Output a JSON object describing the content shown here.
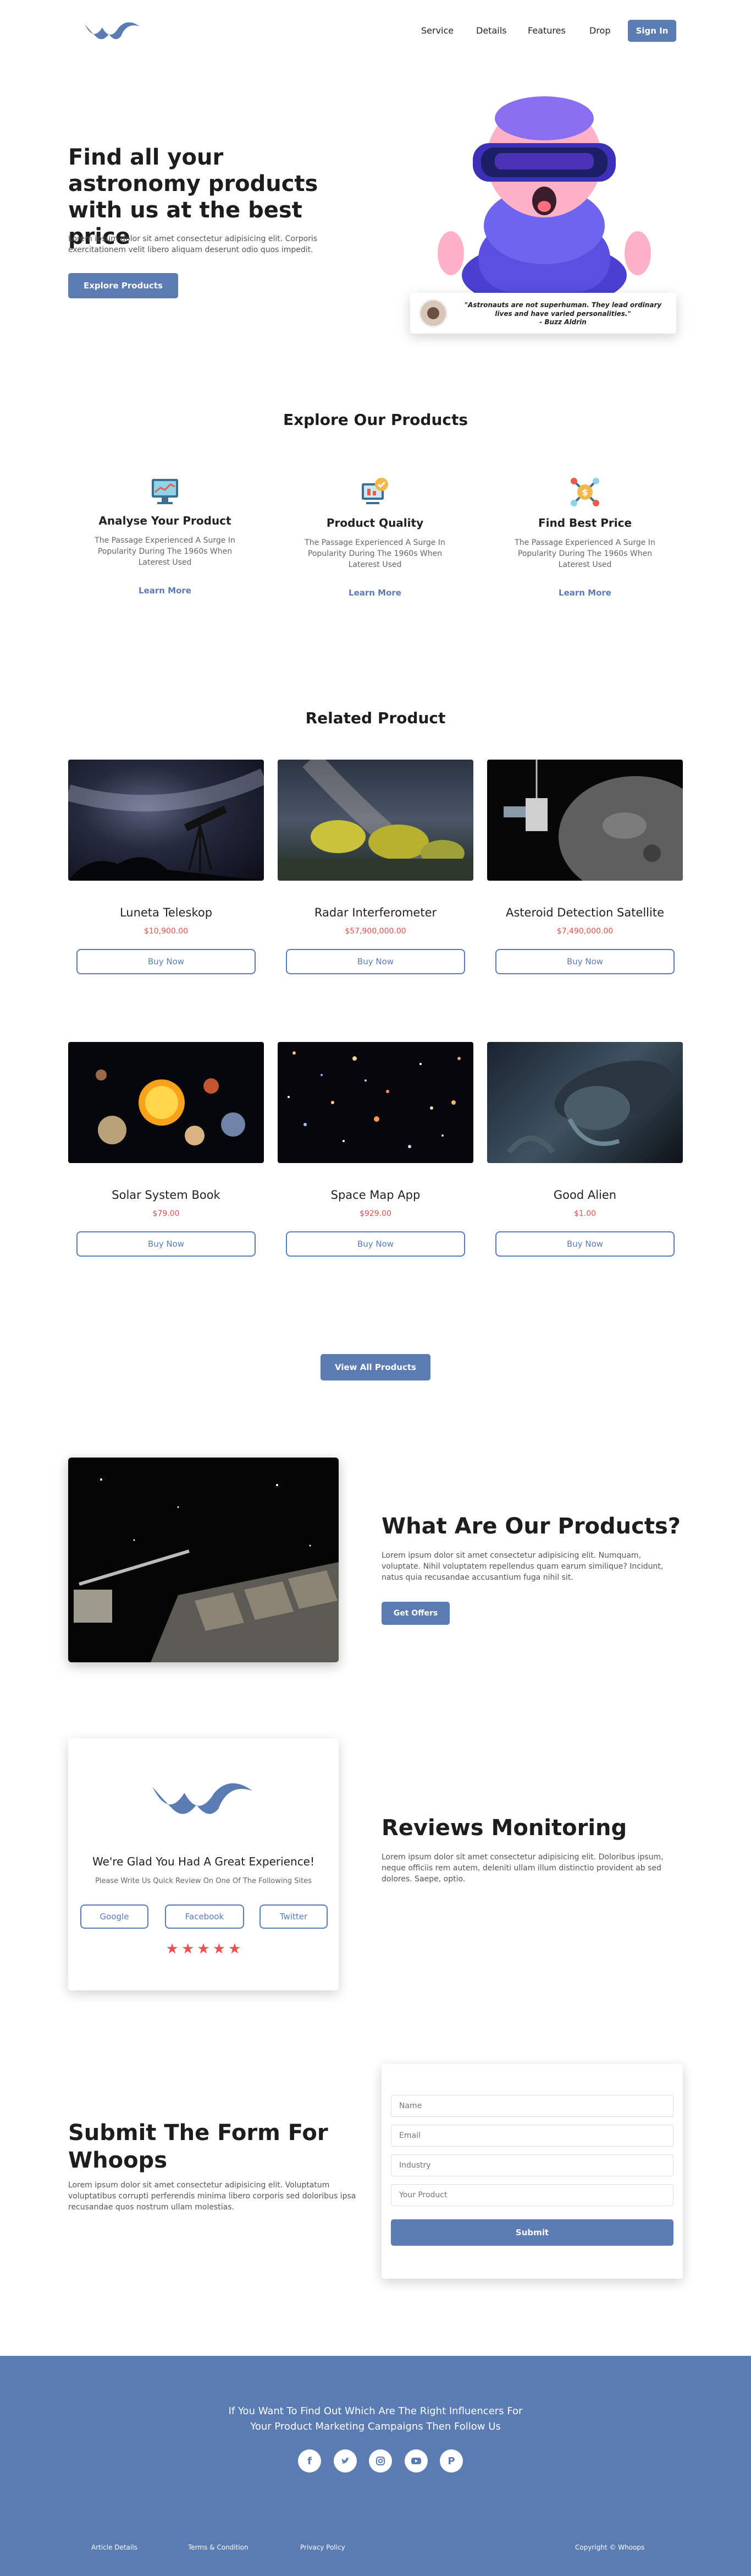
{
  "nav": {
    "items": [
      "Service",
      "Details",
      "Features",
      "Drop"
    ],
    "signin": "Sign In"
  },
  "hero": {
    "title": "Find all your astronomy products with us at the best price",
    "text": "Lorem ipsum dolor sit amet consectetur adipisicing elit. Corporis exercitationem velit libero aliquam deserunt odio quos impedit.",
    "cta": "Explore Products",
    "quote": "\"Astronauts are not superhuman. They lead ordinary lives and have varied personalities.\"",
    "quote_author": "- Buzz Aldrin"
  },
  "explore": {
    "title": "Explore Our Products",
    "features": [
      {
        "icon": "analytics-icon",
        "title": "Analyse Your Product",
        "desc": "The Passage Experienced A Surge In Popularity During The 1960s When Laterest Used",
        "link": "Learn More"
      },
      {
        "icon": "quality-icon",
        "title": "Product Quality",
        "desc": "The Passage Experienced A Surge In Popularity During The 1960s When Laterest Used",
        "link": "Learn More"
      },
      {
        "icon": "price-icon",
        "title": "Find Best Price",
        "desc": "The Passage Experienced A Surge In Popularity During The 1960s When Laterest Used",
        "link": "Learn More"
      }
    ]
  },
  "related": {
    "title": "Related Product",
    "buy_label": "Buy Now",
    "products": [
      {
        "name": "Luneta Teleskop",
        "price": "$10,900.00"
      },
      {
        "name": "Radar Interferometer",
        "price": "$57,900,000.00"
      },
      {
        "name": "Asteroid Detection Satellite",
        "price": "$7,490,000.00"
      },
      {
        "name": "Solar System Book",
        "price": "$79.00"
      },
      {
        "name": "Space Map App",
        "price": "$929.00"
      },
      {
        "name": "Good Alien",
        "price": "$1.00"
      }
    ],
    "view_all": "View All Products"
  },
  "what": {
    "title": "What Are Our Products?",
    "text": "Lorem ipsum dolor sit amet consectetur adipisicing elit. Numquam, voluptate. Nihil voluptatem repellendus quam earum similique? Incidunt, natus quia recusandae accusantium fuga nihil sit.",
    "cta": "Get Offers"
  },
  "reviews": {
    "card_title": "We're Glad You Had A Great Experience!",
    "card_sub": "Please Write Us Quick Review On One Of The Following Sites",
    "sites": [
      "Google",
      "Facebook",
      "Twitter"
    ],
    "rating": 5,
    "title": "Reviews Monitoring",
    "text": "Lorem ipsum dolor sit amet consectetur adipisicing elit. Doloribus ipsum, neque officiis rem autem, deleniti ullam illum distinctio provident ab sed dolores. Saepe, optio."
  },
  "form": {
    "title": "Submit The Form For Whoops",
    "text": "Lorem ipsum dolor sit amet consectetur adipisicing elit. Voluptatum voluptatibus corrupti perferendis minima libero corporis sed doloribus ipsa recusandae quos nostrum ullam molestias.",
    "placeholders": {
      "name": "Name",
      "email": "Email",
      "industry": "Industry",
      "product": "Your Product"
    },
    "submit": "Submit"
  },
  "footer": {
    "line1": "If You Want To Find Out Which Are The Right Influencers For",
    "line2": "Your Product Marketing Campaigns Then Follow Us",
    "social": [
      "facebook-icon",
      "twitter-icon",
      "instagram-icon",
      "youtube-icon",
      "pinterest-icon"
    ],
    "links": [
      "Article Details",
      "Terms & Condition",
      "Privacy Policy"
    ],
    "copyright": "Copyright © Whoops"
  },
  "colors": {
    "accent": "#5b7bb3",
    "price": "#e74c4c",
    "star": "#ee4f4f"
  }
}
